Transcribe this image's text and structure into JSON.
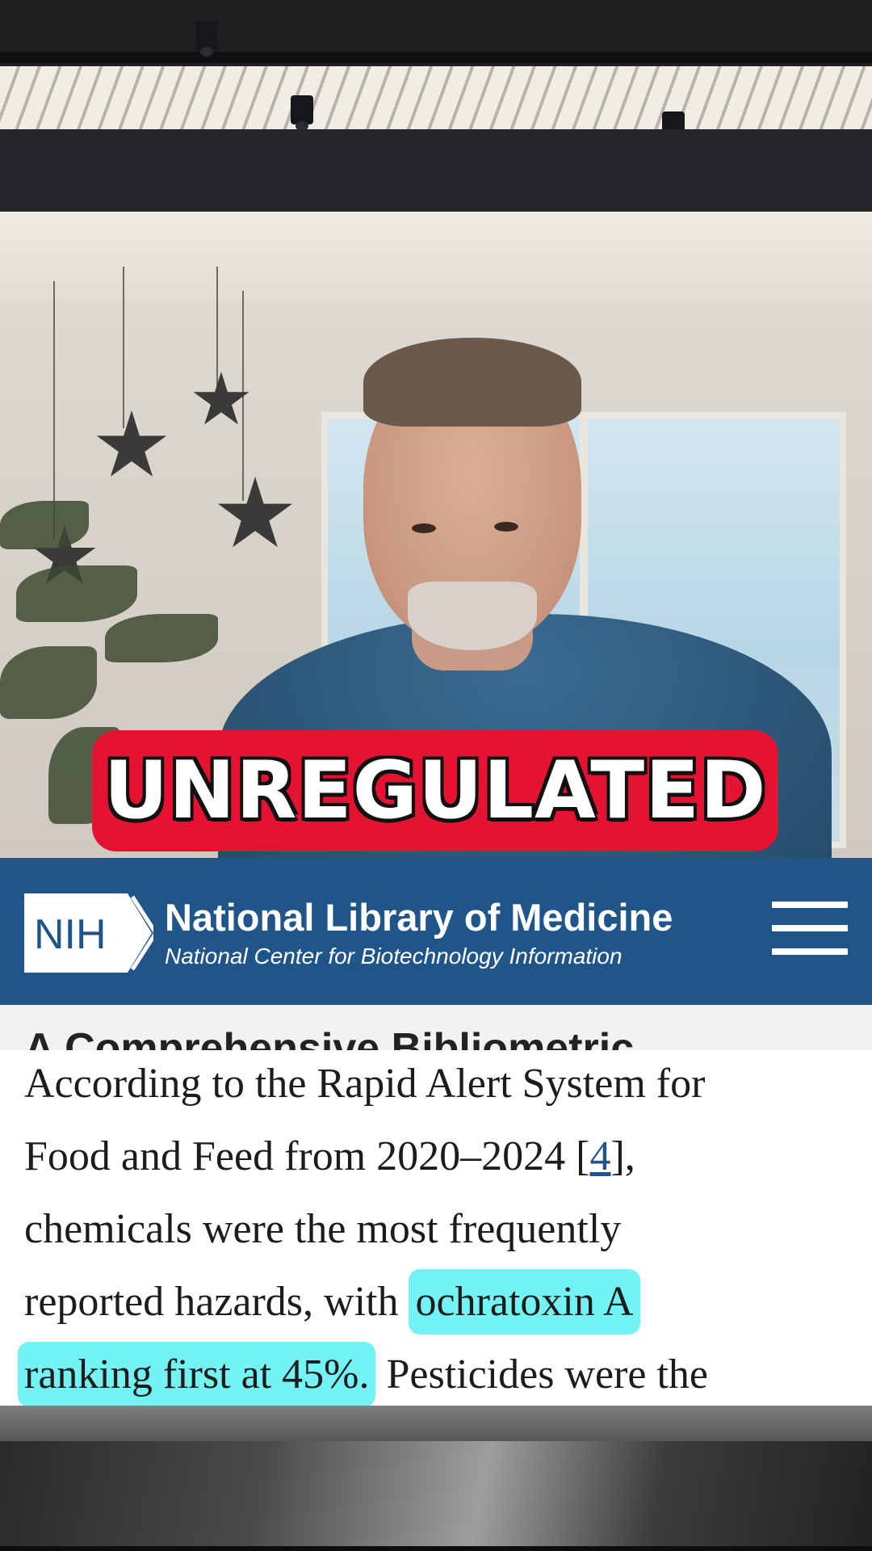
{
  "caption": {
    "text": "UNREGULATED"
  },
  "nih_header": {
    "logo_text": "NIH",
    "title": "National Library of Medicine",
    "subtitle": "National Center for Biotechnology Information"
  },
  "article": {
    "heading_partial": "A Comprehensive Bibliometric",
    "lines": {
      "l1": "According to the Rapid Alert System for",
      "l2_pre": "Food and Feed from 2020–2024 [",
      "l2_ref": "4",
      "l2_post": "],",
      "l3": "chemicals were the most frequently",
      "l4_pre": "reported hazards, with ",
      "l4_highlight": "ochratoxin A",
      "l5_highlight": "ranking first at 45%.",
      "l5_post": " Pesticides were the"
    }
  },
  "colors": {
    "caption_bg": "#e41331",
    "nih_blue": "#20558a",
    "highlight": "#73f3f4",
    "link": "#205493"
  },
  "icons": {
    "menu": "hamburger-menu-icon",
    "logo": "nih-logo-icon"
  }
}
